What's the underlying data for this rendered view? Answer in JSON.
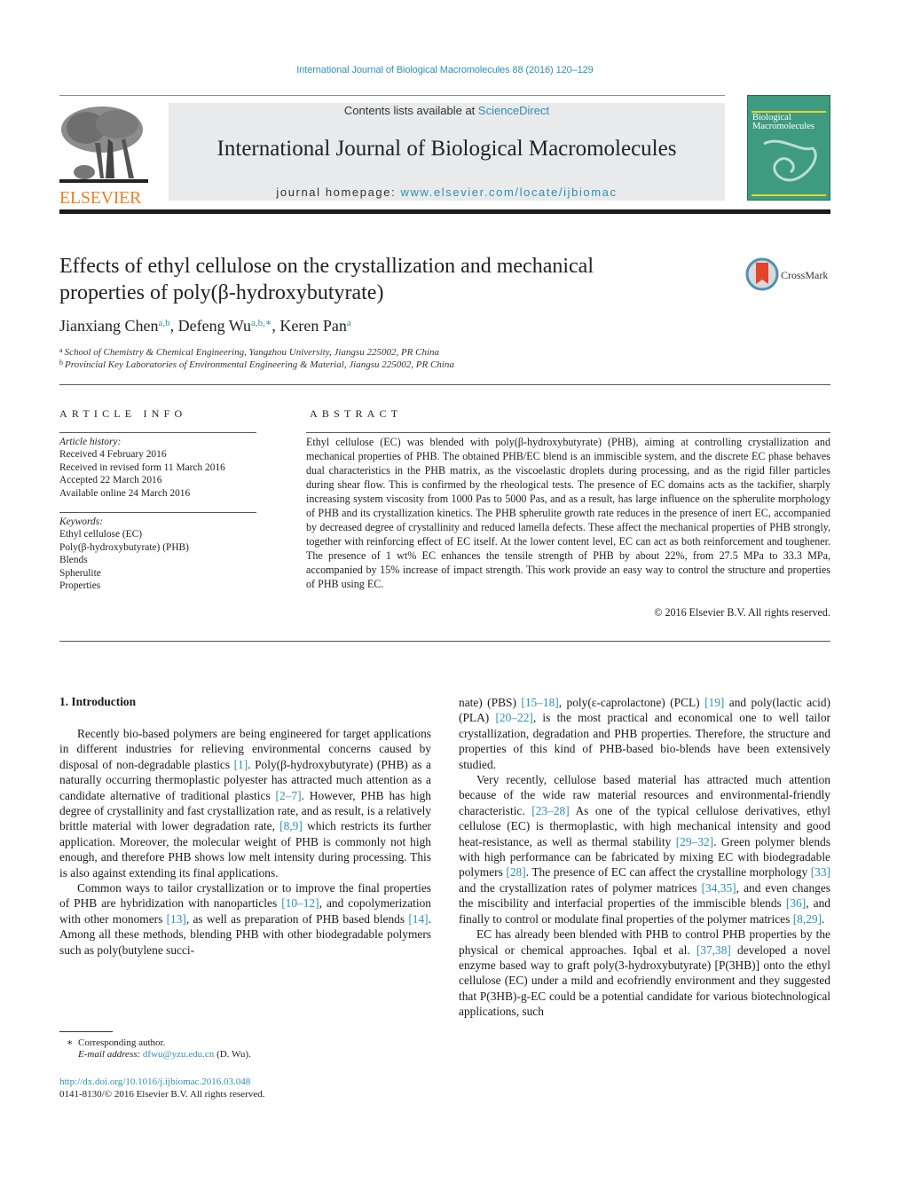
{
  "header": {
    "journal_ref": "International Journal of Biological Macromolecules 88 (2016) 120–129",
    "contents_prefix": "Contents lists available at ",
    "contents_link": "ScienceDirect",
    "journal_name": "International Journal of Biological Macromolecules",
    "homepage_prefix": "journal homepage: ",
    "homepage_link": "www.elsevier.com/locate/ijbiomac",
    "publisher_logo": "ELSEVIER",
    "cover_title_1": "Biological",
    "cover_title_2": "Macromolecules",
    "crossmark_label": "CrossMark",
    "colors": {
      "link": "#2e8fb4",
      "elsevier_orange": "#f07f1e",
      "cover_green": "#3f9b80"
    }
  },
  "article": {
    "title_line1": "Effects of ethyl cellulose on the crystallization and mechanical",
    "title_line2": "properties of poly(β-hydroxybutyrate)",
    "authors": [
      {
        "name": "Jianxiang Chen",
        "sup": "a,b"
      },
      {
        "name": "Defeng Wu",
        "sup": "a,b,∗"
      },
      {
        "name": "Keren Pan",
        "sup": "a"
      }
    ],
    "affiliations": [
      {
        "key": "a",
        "text": "School of Chemistry & Chemical Engineering, Yangzhou University, Jiangsu 225002, PR China"
      },
      {
        "key": "b",
        "text": "Provincial Key Laboratories of Environmental Engineering & Material, Jiangsu 225002, PR China"
      }
    ]
  },
  "article_info": {
    "heading": "ARTICLE INFO",
    "history_label": "Article history:",
    "history": [
      "Received 4 February 2016",
      "Received in revised form 11 March 2016",
      "Accepted 22 March 2016",
      "Available online 24 March 2016"
    ],
    "keywords_label": "Keywords:",
    "keywords": [
      "Ethyl cellulose (EC)",
      "Poly(β-hydroxybutyrate) (PHB)",
      "Blends",
      "Spherulite",
      "Properties"
    ]
  },
  "abstract": {
    "heading": "ABSTRACT",
    "text": "Ethyl cellulose (EC) was blended with poly(β-hydroxybutyrate) (PHB), aiming at controlling crystallization and mechanical properties of PHB. The obtained PHB/EC blend is an immiscible system, and the discrete EC phase behaves dual characteristics in the PHB matrix, as the viscoelastic droplets during processing, and as the rigid filler particles during shear flow. This is confirmed by the rheological tests. The presence of EC domains acts as the tackifier, sharply increasing system viscosity from 1000 Pas to 5000 Pas, and as a result, has large influence on the spherulite morphology of PHB and its crystallization kinetics. The PHB spherulite growth rate reduces in the presence of inert EC, accompanied by decreased degree of crystallinity and reduced lamella defects. These affect the mechanical properties of PHB strongly, together with reinforcing effect of EC itself. At the lower content level, EC can act as both reinforcement and toughener. The presence of 1 wt% EC enhances the tensile strength of PHB by about 22%, from 27.5 MPa to 33.3 MPa, accompanied by 15% increase of impact strength. This work provide an easy way to control the structure and properties of PHB using EC.",
    "copyright": "© 2016 Elsevier B.V. All rights reserved."
  },
  "body": {
    "section_heading": "1.  Introduction",
    "left": {
      "p1": [
        "Recently bio-based polymers are being engineered for target applications in different industries for relieving environmental concerns caused by disposal of non-degradable plastics ",
        "[1]",
        ". Poly(β-hydroxybutyrate) (PHB) as a naturally occurring thermoplastic polyester has attracted much attention as a candidate alternative of traditional plastics ",
        "[2–7]",
        ". However, PHB has high degree of crystallinity and fast crystallization rate, and as result, is a relatively brittle material with lower degradation rate, ",
        "[8,9]",
        " which restricts its further application. Moreover, the molecular weight of PHB is commonly not high enough, and therefore PHB shows low melt intensity during processing. This is also against extending its final applications."
      ],
      "p2": [
        "Common ways to tailor crystallization or to improve the final properties of PHB are hybridization with nanoparticles ",
        "[10–12]",
        ", and copolymerization with other monomers ",
        "[13]",
        ", as well as preparation of PHB based blends ",
        "[14]",
        ". Among all these methods, blending PHB with other biodegradable polymers such as poly(butylene succi-"
      ]
    },
    "right": {
      "p0": [
        "nate) (PBS) ",
        "[15–18]",
        ", poly(ε-caprolactone) (PCL) ",
        "[19]",
        " and poly(lactic acid) (PLA) ",
        "[20–22]",
        ", is the most practical and economical one to well tailor crystallization, degradation and PHB properties. Therefore, the structure and properties of this kind of PHB-based bio-blends have been extensively studied."
      ],
      "p1": [
        "Very recently, cellulose based material has attracted much attention because of the wide raw material resources and environmental-friendly characteristic. ",
        "[23–28]",
        " As one of the typical cellulose derivatives, ethyl cellulose (EC) is thermoplastic, with high mechanical intensity and good heat-resistance, as well as thermal stability ",
        "[29–32]",
        ". Green polymer blends with high performance can be fabricated by mixing EC with biodegradable polymers ",
        "[28]",
        ". The presence of EC can affect the crystalline morphology ",
        "[33]",
        " and the crystallization rates of polymer matrices ",
        "[34,35]",
        ", and even changes the miscibility and interfacial properties of the immiscible blends ",
        "[36]",
        ", and finally to control or modulate final properties of the polymer matrices ",
        "[8,29]",
        "."
      ],
      "p2": [
        "EC has already been blended with PHB to control PHB properties by the physical or chemical approaches. Iqbal et al. ",
        "[37,38]",
        " developed a novel enzyme based way to graft poly(3-hydroxybutyrate) [P(3HB)] onto the ethyl cellulose (EC) under a mild and ecofriendly environment and they suggested that P(3HB)-g-EC could be a potential candidate for various biotechnological applications, such"
      ]
    }
  },
  "footer": {
    "corresponding_mark": "∗",
    "corresponding": "Corresponding author.",
    "email_label": "E-mail address:",
    "email": "dfwu@yzu.edu.cn",
    "email_suffix": " (D. Wu).",
    "doi": "http://dx.doi.org/10.1016/j.ijbiomac.2016.03.048",
    "issn": "0141-8130/© 2016 Elsevier B.V. All rights reserved."
  }
}
